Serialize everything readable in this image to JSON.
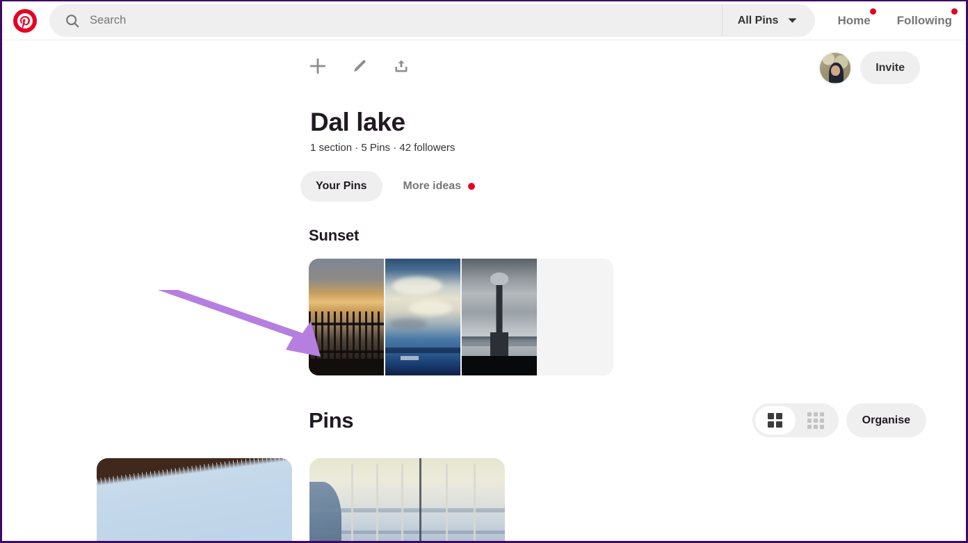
{
  "header": {
    "logo_icon": "pinterest-logo-icon",
    "search": {
      "icon": "search-icon",
      "placeholder": "Search",
      "value": ""
    },
    "filter": {
      "label": "All Pins",
      "icon": "chevron-down-icon"
    },
    "nav": [
      {
        "label": "Home",
        "has_notification": true
      },
      {
        "label": "Following",
        "has_notification": true
      }
    ]
  },
  "board_tools": {
    "add_icon": "plus-icon",
    "edit_icon": "pencil-icon",
    "share_icon": "share-upload-icon",
    "avatar": "user-avatar",
    "invite_label": "Invite"
  },
  "board": {
    "title": "Dal lake",
    "meta": "1 section · 5 Pins · 42 followers",
    "meta_parts": {
      "sections": "1 section",
      "pins": "5 Pins",
      "followers": "42 followers"
    }
  },
  "tabs": [
    {
      "label": "Your Pins",
      "active": true,
      "has_notification": false
    },
    {
      "label": "More ideas",
      "active": false,
      "has_notification": true
    }
  ],
  "section": {
    "title": "Sunset",
    "thumbnails": [
      {
        "alt": "sunset-over-fence-thumbnail"
      },
      {
        "alt": "cloudy-blue-sky-over-lake-thumbnail"
      },
      {
        "alt": "lamp-post-monument-thumbnail"
      }
    ],
    "empty_slot": true
  },
  "pins_section": {
    "title": "Pins",
    "view_toggle": [
      {
        "icon": "grid-2x2-icon",
        "active": true
      },
      {
        "icon": "grid-3x3-icon",
        "active": false
      }
    ],
    "organise_label": "Organise",
    "pins": [
      {
        "alt": "roof-edge-against-blue-sky-pin"
      },
      {
        "alt": "hazy-lake-shoreline-pin"
      }
    ]
  },
  "annotation": {
    "type": "arrow",
    "color": "#b57fe0",
    "points_to": "first-sunset-thumbnail"
  },
  "colors": {
    "brand_red": "#e60023",
    "notification_red": "#e60023",
    "neutral_bg": "#efefef",
    "text_dark": "#211922",
    "text_muted": "#767676",
    "page_border": "#3d0a63",
    "annotation_purple": "#b57fe0"
  }
}
